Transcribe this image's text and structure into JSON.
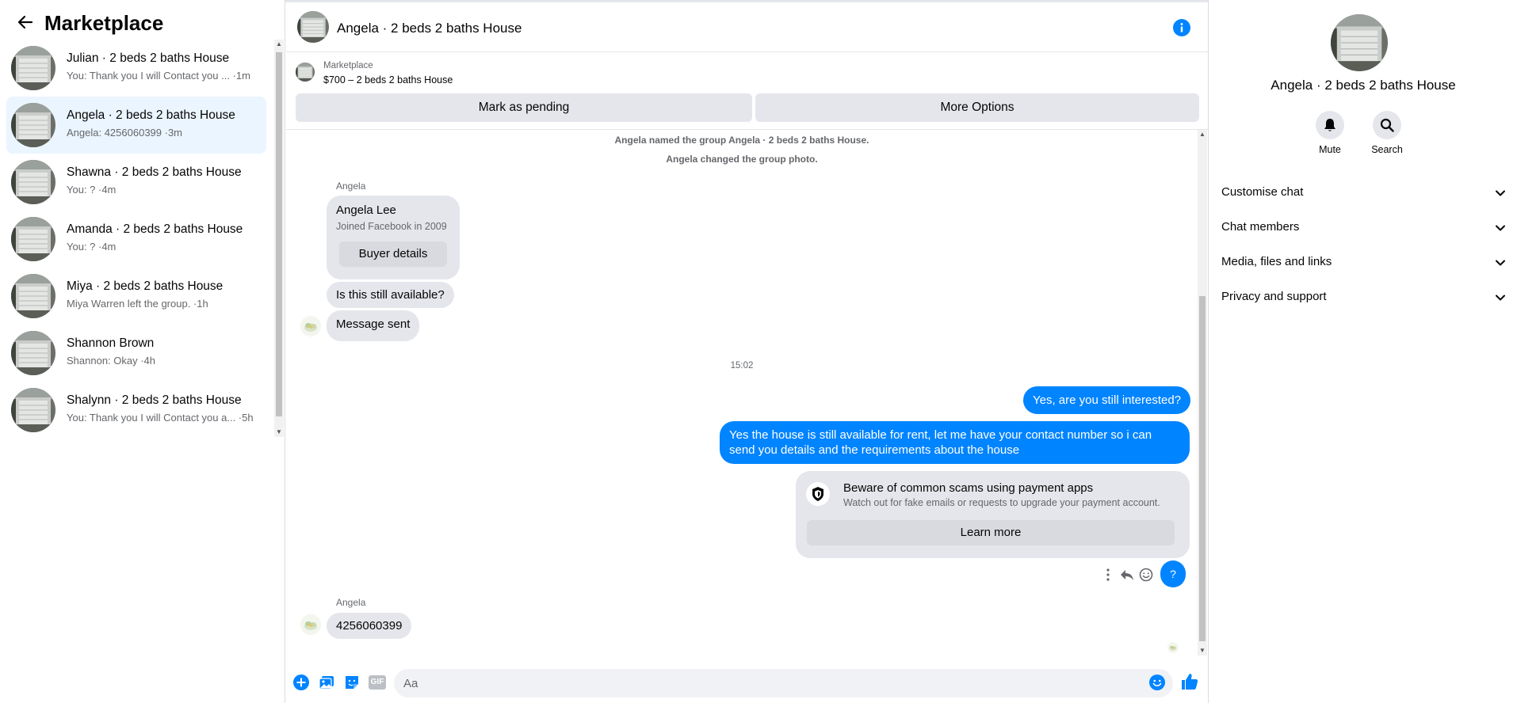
{
  "sidebar": {
    "title": "Marketplace",
    "conversations": [
      {
        "name": "Julian · 2 beds 2 baths House",
        "preview": "You: Thank you I will Contact you ... ·1m"
      },
      {
        "name": "Angela · 2 beds 2 baths House",
        "preview": "Angela: 4256060399 ·3m"
      },
      {
        "name": "Shawna · 2 beds 2 baths House",
        "preview": "You: ? ·4m"
      },
      {
        "name": "Amanda · 2 beds 2 baths House",
        "preview": "You: ? ·4m"
      },
      {
        "name": "Miya · 2 beds 2 baths House",
        "preview": "Miya Warren left the group. ·1h"
      },
      {
        "name": "Shannon Brown",
        "preview": "Shannon: Okay ·4h"
      },
      {
        "name": "Shalynn · 2 beds 2 baths House",
        "preview": "You: Thank you I will Contact you a... ·5h"
      }
    ]
  },
  "chat": {
    "title": "Angela · 2 beds 2 baths House",
    "listing": {
      "source": "Marketplace",
      "price_title": "$700 – 2 beds 2 baths House",
      "mark_pending": "Mark as pending",
      "more_options": "More Options"
    },
    "system_1": "Angela named the group Angela · 2 beds 2 baths House.",
    "system_2": "Angela changed the group photo.",
    "sender_1": "Angela",
    "buyer": {
      "name": "Angela Lee",
      "joined": "Joined Facebook in 2009",
      "button": "Buyer details"
    },
    "msg_available": "Is this still available?",
    "msg_sent": "Message sent",
    "timestamp": "15:02",
    "out_1": "Yes, are you still interested?",
    "out_2": "Yes the house is still available for rent, let me have your contact number so i can send you details and the requirements about the house",
    "scam": {
      "title": "Beware of common scams using payment apps",
      "subtitle": "Watch out for fake emails or requests to upgrade your payment account.",
      "button": "Learn more"
    },
    "q_bubble": "?",
    "sender_2": "Angela",
    "msg_number": "4256060399",
    "composer_placeholder": "Aa",
    "gif_label": "GIF"
  },
  "info_panel": {
    "name": "Angela · 2 beds 2 baths House",
    "mute_label": "Mute",
    "search_label": "Search",
    "sections": [
      "Customise chat",
      "Chat members",
      "Media, files and links",
      "Privacy and support"
    ]
  },
  "colors": {
    "accent": "#0084ff",
    "bubble_in": "#e4e6eb",
    "secondary_text": "#65676b",
    "active_row": "#ebf5ff"
  }
}
